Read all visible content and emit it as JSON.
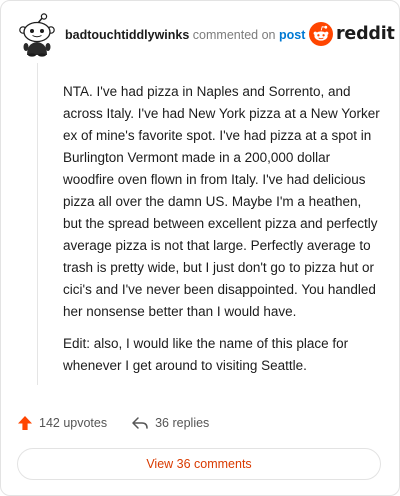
{
  "comment": {
    "username": "badtouchtiddlywinks",
    "action_text": "commented on",
    "target_link": "post",
    "paragraphs": [
      "NTA. I've had pizza in Naples and Sorrento, and across Italy. I've had New York pizza at a New Yorker ex of mine's favorite spot. I've had pizza at a spot in Burlington Vermont made in a 200,000 dollar woodfire oven flown in from Italy. I've had delicious pizza all over the damn US. Maybe I'm a heathen, but the spread between excellent pizza and perfectly average pizza is not that large. Perfectly average to trash is pretty wide, but I just don't go to pizza hut or cici's and I've never been disappointed. You handled her nonsense better than I would have.",
      "Edit: also, I would like the name of this place for whenever I get around to visiting Seattle."
    ]
  },
  "brand": {
    "wordmark": "reddit",
    "icon": "reddit-snoo-icon",
    "color": "#ff4500"
  },
  "stats": {
    "upvotes": "142 upvotes",
    "replies": "36 replies",
    "upvote_icon": "upvote-arrow-icon",
    "reply_icon": "reply-arrow-icon"
  },
  "footer": {
    "view_comments": "View 36 comments",
    "accent": "#d93a00"
  },
  "avatar": {
    "icon": "snoo-avatar-icon"
  }
}
